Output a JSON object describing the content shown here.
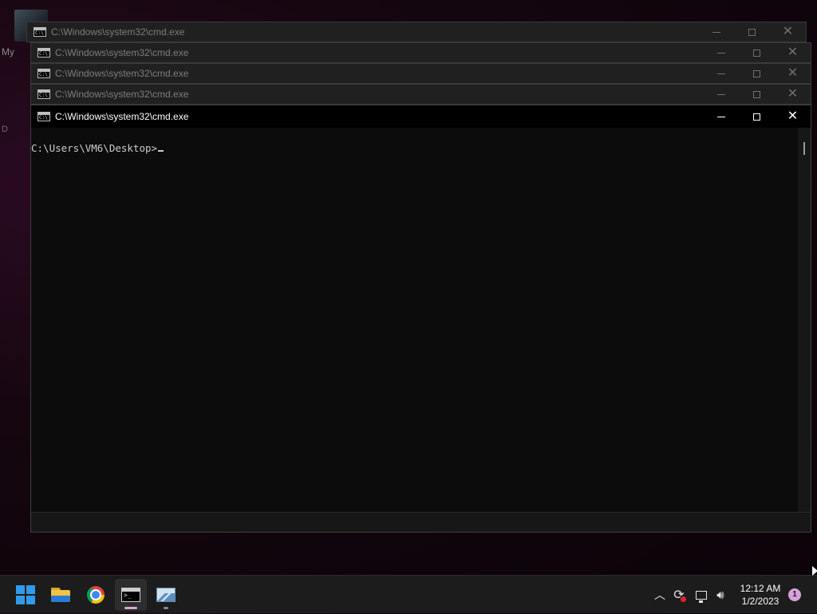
{
  "desktop": {
    "label_my": "My",
    "label_da": "D"
  },
  "windows": {
    "background_titles": [
      "C:\\Windows\\system32\\cmd.exe",
      "C:\\Windows\\system32\\cmd.exe",
      "C:\\Windows\\system32\\cmd.exe",
      "C:\\Windows\\system32\\cmd.exe"
    ],
    "main": {
      "title": "C:\\Windows\\system32\\cmd.exe",
      "prompt": "C:\\Users\\VM6\\Desktop>"
    }
  },
  "taskbar": {
    "apps": [
      "start-icon",
      "file-explorer-icon",
      "chrome-icon",
      "cmd-icon",
      "resource-monitor-icon"
    ],
    "active_app": "cmd-icon",
    "tray": {
      "time": "12:12 AM",
      "date": "1/2/2023",
      "notification_count": "1"
    }
  },
  "colors": {
    "accent": "#d9a4d4",
    "console_bg": "#0c0c0c",
    "console_text": "#cccccc",
    "start_blue": "#2f9bea"
  }
}
